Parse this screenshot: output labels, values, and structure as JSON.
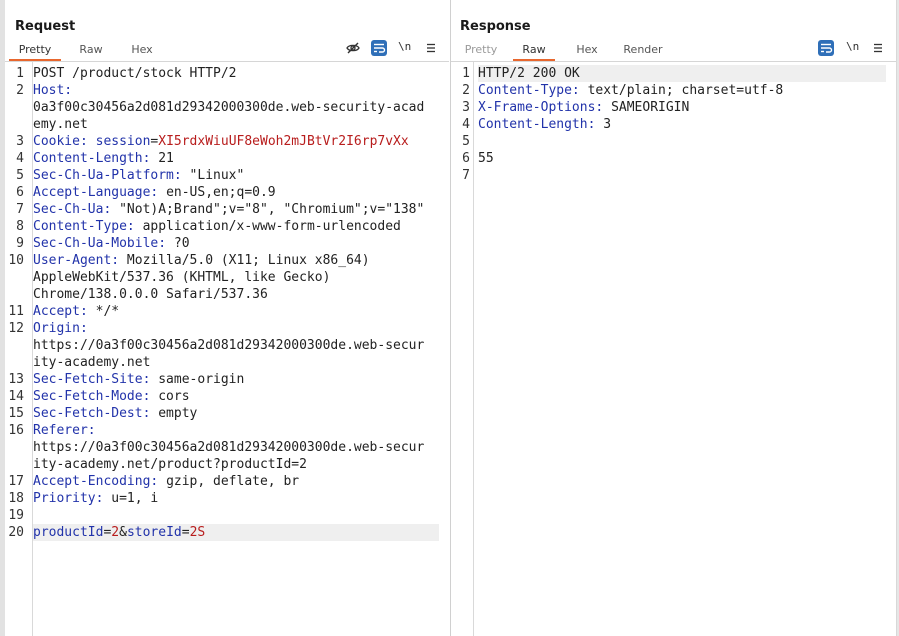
{
  "request": {
    "title": "Request",
    "tabs": [
      "Pretty",
      "Raw",
      "Hex"
    ],
    "active_tab": "Pretty",
    "newline_toggle": "\\n",
    "lines": [
      {
        "n": "1",
        "segs": [
          {
            "t": "POST /product/stock HTTP/2",
            "c": "hval"
          }
        ]
      },
      {
        "n": "2",
        "segs": [
          {
            "t": "Host:",
            "c": "hname"
          }
        ]
      },
      {
        "n": "",
        "segs": [
          {
            "t": "0a3f00c30456a2d081d29342000300de.web-security-acad",
            "c": "hval"
          }
        ]
      },
      {
        "n": "",
        "segs": [
          {
            "t": "emy.net",
            "c": "hval"
          }
        ]
      },
      {
        "n": "3",
        "segs": [
          {
            "t": "Cookie: ",
            "c": "hname"
          },
          {
            "t": "session",
            "c": "blue"
          },
          {
            "t": "=",
            "c": "hval"
          },
          {
            "t": "XI5rdxWiuUF8eWoh2mJBtVr2I6rp7vXx",
            "c": "red"
          }
        ]
      },
      {
        "n": "4",
        "segs": [
          {
            "t": "Content-Length: ",
            "c": "hname"
          },
          {
            "t": "21",
            "c": "hval"
          }
        ]
      },
      {
        "n": "5",
        "segs": [
          {
            "t": "Sec-Ch-Ua-Platform: ",
            "c": "hname"
          },
          {
            "t": "\"Linux\"",
            "c": "hval"
          }
        ]
      },
      {
        "n": "6",
        "segs": [
          {
            "t": "Accept-Language: ",
            "c": "hname"
          },
          {
            "t": "en-US,en;q=0.9",
            "c": "hval"
          }
        ]
      },
      {
        "n": "7",
        "segs": [
          {
            "t": "Sec-Ch-Ua: ",
            "c": "hname"
          },
          {
            "t": "\"Not)A;Brand\";v=\"8\", \"Chromium\";v=\"138\"",
            "c": "hval"
          }
        ]
      },
      {
        "n": "8",
        "segs": [
          {
            "t": "Content-Type: ",
            "c": "hname"
          },
          {
            "t": "application/x-www-form-urlencoded",
            "c": "hval"
          }
        ]
      },
      {
        "n": "9",
        "segs": [
          {
            "t": "Sec-Ch-Ua-Mobile: ",
            "c": "hname"
          },
          {
            "t": "?0",
            "c": "hval"
          }
        ]
      },
      {
        "n": "10",
        "segs": [
          {
            "t": "User-Agent: ",
            "c": "hname"
          },
          {
            "t": "Mozilla/5.0 (X11; Linux x86_64)",
            "c": "hval"
          }
        ]
      },
      {
        "n": "",
        "segs": [
          {
            "t": "AppleWebKit/537.36 (KHTML, like Gecko)",
            "c": "hval"
          }
        ]
      },
      {
        "n": "",
        "segs": [
          {
            "t": "Chrome/138.0.0.0 Safari/537.36",
            "c": "hval"
          }
        ]
      },
      {
        "n": "11",
        "segs": [
          {
            "t": "Accept: ",
            "c": "hname"
          },
          {
            "t": "*/*",
            "c": "hval"
          }
        ]
      },
      {
        "n": "12",
        "segs": [
          {
            "t": "Origin:",
            "c": "hname"
          }
        ]
      },
      {
        "n": "",
        "segs": [
          {
            "t": "https://0a3f00c30456a2d081d29342000300de.web-secur",
            "c": "hval"
          }
        ]
      },
      {
        "n": "",
        "segs": [
          {
            "t": "ity-academy.net",
            "c": "hval"
          }
        ]
      },
      {
        "n": "13",
        "segs": [
          {
            "t": "Sec-Fetch-Site: ",
            "c": "hname"
          },
          {
            "t": "same-origin",
            "c": "hval"
          }
        ]
      },
      {
        "n": "14",
        "segs": [
          {
            "t": "Sec-Fetch-Mode: ",
            "c": "hname"
          },
          {
            "t": "cors",
            "c": "hval"
          }
        ]
      },
      {
        "n": "15",
        "segs": [
          {
            "t": "Sec-Fetch-Dest: ",
            "c": "hname"
          },
          {
            "t": "empty",
            "c": "hval"
          }
        ]
      },
      {
        "n": "16",
        "segs": [
          {
            "t": "Referer:",
            "c": "hname"
          }
        ]
      },
      {
        "n": "",
        "segs": [
          {
            "t": "https://0a3f00c30456a2d081d29342000300de.web-secur",
            "c": "hval"
          }
        ]
      },
      {
        "n": "",
        "segs": [
          {
            "t": "ity-academy.net/product?productId=2",
            "c": "hval"
          }
        ]
      },
      {
        "n": "17",
        "segs": [
          {
            "t": "Accept-Encoding: ",
            "c": "hname"
          },
          {
            "t": "gzip, deflate, br",
            "c": "hval"
          }
        ]
      },
      {
        "n": "18",
        "segs": [
          {
            "t": "Priority: ",
            "c": "hname"
          },
          {
            "t": "u=1, i",
            "c": "hval"
          }
        ]
      },
      {
        "n": "19",
        "segs": []
      },
      {
        "n": "20",
        "hl": true,
        "segs": [
          {
            "t": "productId",
            "c": "blue"
          },
          {
            "t": "=",
            "c": "hval"
          },
          {
            "t": "2",
            "c": "red"
          },
          {
            "t": "&",
            "c": "hval"
          },
          {
            "t": "storeId",
            "c": "blue"
          },
          {
            "t": "=",
            "c": "hval"
          },
          {
            "t": "2S",
            "c": "red"
          }
        ]
      }
    ]
  },
  "response": {
    "title": "Response",
    "tabs": [
      "Pretty",
      "Raw",
      "Hex",
      "Render"
    ],
    "active_tab": "Raw",
    "newline_toggle": "\\n",
    "lines": [
      {
        "n": "1",
        "hl": true,
        "segs": [
          {
            "t": "HTTP/2 200 OK",
            "c": "hval"
          }
        ]
      },
      {
        "n": "2",
        "segs": [
          {
            "t": "Content-Type: ",
            "c": "hname"
          },
          {
            "t": "text/plain; charset=utf-8",
            "c": "hval"
          }
        ]
      },
      {
        "n": "3",
        "segs": [
          {
            "t": "X-Frame-Options: ",
            "c": "hname"
          },
          {
            "t": "SAMEORIGIN",
            "c": "hval"
          }
        ]
      },
      {
        "n": "4",
        "segs": [
          {
            "t": "Content-Length: ",
            "c": "hname"
          },
          {
            "t": "3",
            "c": "hval"
          }
        ]
      },
      {
        "n": "5",
        "segs": []
      },
      {
        "n": "6",
        "segs": [
          {
            "t": "55",
            "c": "hval"
          }
        ]
      },
      {
        "n": "7",
        "segs": []
      }
    ]
  },
  "colors": {
    "accent_tab": "#e8672e",
    "header_name": "#2233aa",
    "param_value": "#b81d1d",
    "toggle_active": "#2f6fb8"
  },
  "icons": [
    "eye-off-icon",
    "wrap-lines-icon",
    "menu-icon",
    "layout-split-icon",
    "layout-horizontal-icon",
    "layout-tabs-icon"
  ]
}
